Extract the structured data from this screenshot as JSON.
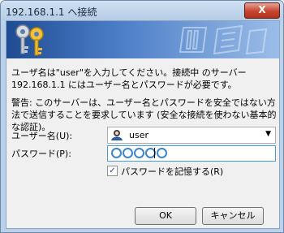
{
  "window": {
    "title": "192.168.1.1 へ接続",
    "close_label": "X"
  },
  "message": "ユーザ名は\"user\"を入力してください。接続中 のサーバー 192.168.1.1 にはユーザー名とパスワードが必要です。",
  "warning": "警告: このサーバーは、ユーザー名とパスワードを安全ではない方法で送信することを要求しています (安全な接続を使わない基本的な認証)。",
  "username": {
    "label": "ユーザー名(U):",
    "value": "user",
    "icon": "user-icon"
  },
  "password": {
    "label": "パスワード(P):",
    "masked_length": 5
  },
  "remember": {
    "label": "パスワードを記憶する(R)",
    "checked": true
  },
  "buttons": {
    "ok": "OK",
    "cancel": "キャンセル"
  }
}
